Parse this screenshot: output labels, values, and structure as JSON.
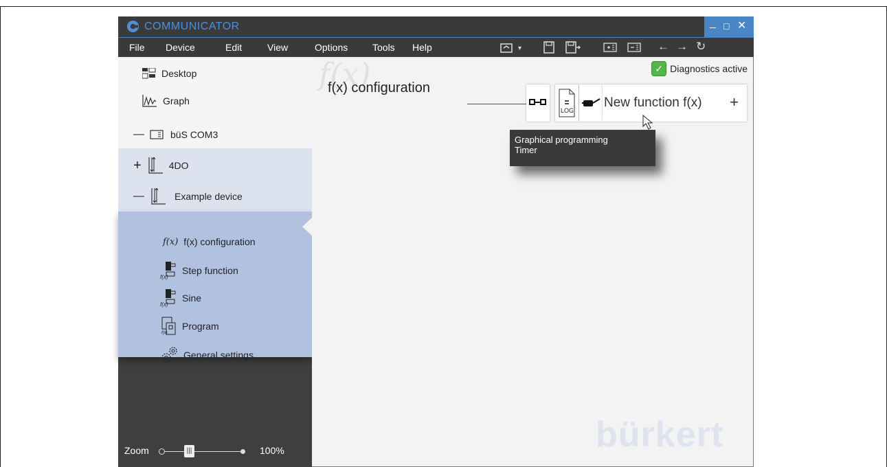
{
  "app": {
    "title": "COMMUNICATOR"
  },
  "menu": [
    "File",
    "Device",
    "Edit",
    "View",
    "Options",
    "Tools",
    "Help"
  ],
  "sidebar": {
    "desktop": "Desktop",
    "graph": "Graph",
    "bus": "büS COM3",
    "device1": "4DO",
    "device2": "Example device",
    "items": [
      {
        "label": "f(x) configuration",
        "icon": "fx-icon"
      },
      {
        "label": "Step function",
        "icon": "step-function-icon"
      },
      {
        "label": "Sine",
        "icon": "sine-icon"
      },
      {
        "label": "Program",
        "icon": "program-icon"
      },
      {
        "label": "General settings",
        "icon": "gears-icon"
      }
    ],
    "fx_icon_text": "f(x)"
  },
  "zoom": {
    "label": "Zoom",
    "value": "100%"
  },
  "main": {
    "fx_watermark": "f(x)",
    "title": "f(x) configuration",
    "diagnostics": "Diagnostics active",
    "new_function": "New function f(x)",
    "plus": "+",
    "log_text": "LOG",
    "brand": "bürkert"
  },
  "tooltip": {
    "line1": "Graphical programming",
    "line2": "Timer"
  },
  "colors": {
    "accent": "#4a86c5",
    "sidebar_selected": "#b1c2e1",
    "diagnostics_ok": "#55b648"
  }
}
